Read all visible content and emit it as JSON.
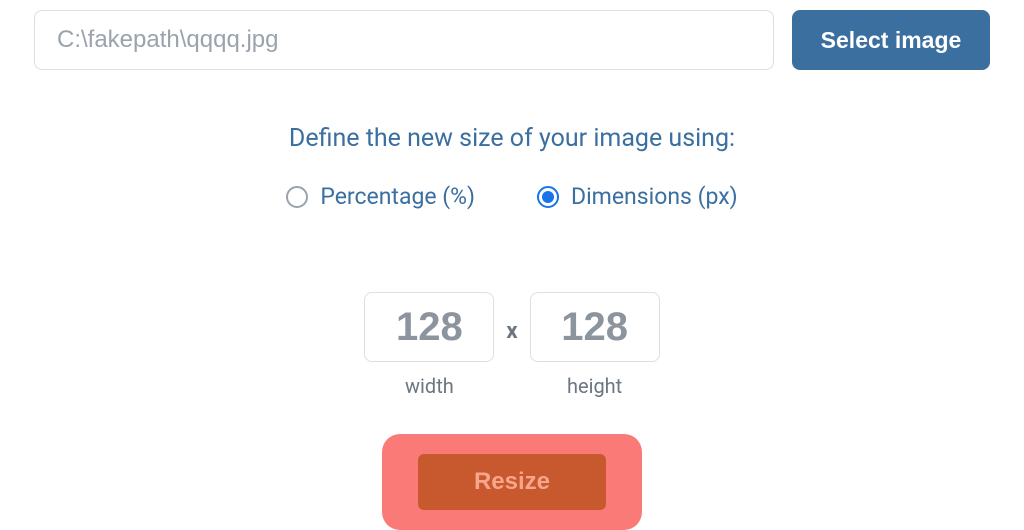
{
  "file": {
    "path": "C:\\fakepath\\qqqq.jpg"
  },
  "select_button_label": "Select image",
  "instruction_text": "Define the new size of your image using:",
  "size_mode": {
    "options": [
      {
        "label": "Percentage (%)",
        "selected": false
      },
      {
        "label": "Dimensions (px)",
        "selected": true
      }
    ]
  },
  "dimensions": {
    "width_value": "128",
    "width_label": "width",
    "separator": "x",
    "height_value": "128",
    "height_label": "height"
  },
  "resize_button_label": "Resize"
}
